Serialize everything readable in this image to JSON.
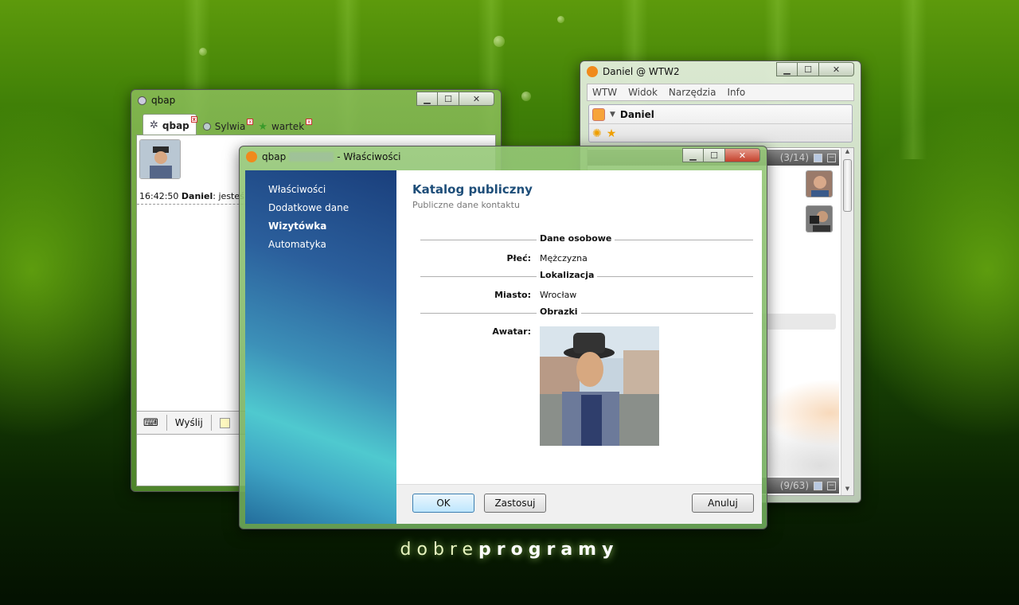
{
  "chat_window": {
    "title": "qbap",
    "tabs": [
      {
        "label": "qbap"
      },
      {
        "label": "Sylwia"
      },
      {
        "label": "wartek"
      }
    ],
    "message_time": "16:42:50",
    "message_author": "Daniel",
    "message_text": ": jesteś m",
    "send_label": "Wyślij"
  },
  "wtw_window": {
    "title": "Daniel @ WTW2",
    "menu": [
      "WTW",
      "Widok",
      "Narzędzia",
      "Info"
    ],
    "user_name": "Daniel",
    "group1_count": "(3/14)",
    "group2_count": "(9/63)"
  },
  "dialog": {
    "title_prefix": "qbap",
    "title_suffix": "- Właściwości",
    "nav": [
      "Właściwości",
      "Dodatkowe dane",
      "Wizytówka",
      "Automatyka"
    ],
    "selected_nav": "Wizytówka",
    "heading": "Katalog publiczny",
    "subheading": "Publiczne dane kontaktu",
    "sections": {
      "personal": "Dane osobowe",
      "location": "Lokalizacja",
      "images": "Obrazki"
    },
    "fields": {
      "gender_label": "Płeć:",
      "gender_value": "Mężczyzna",
      "city_label": "Miasto:",
      "city_value": "Wrocław",
      "avatar_label": "Awatar:"
    },
    "buttons": {
      "ok": "OK",
      "apply": "Zastosuj",
      "cancel": "Anuluj"
    }
  },
  "branding": {
    "part1": "dobre",
    "part2": "programy"
  },
  "colors": {
    "accent": "#1e4e79",
    "background": "#2b6206",
    "brand_glow": "#e8f5c0"
  }
}
